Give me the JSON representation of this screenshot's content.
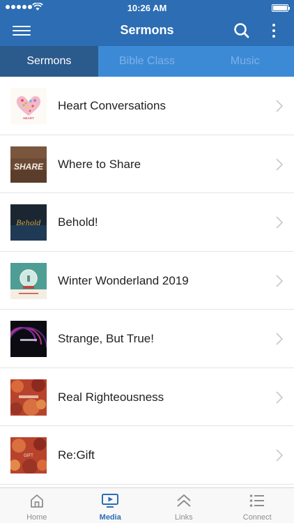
{
  "status_bar": {
    "time": "10:26 AM"
  },
  "header": {
    "title": "Sermons"
  },
  "tabs": [
    {
      "label": "Sermons",
      "active": true
    },
    {
      "label": "Bible Class",
      "active": false
    },
    {
      "label": "Music",
      "active": false
    }
  ],
  "sermons": [
    {
      "title": "Heart Conversations",
      "thumb_text": "HEART"
    },
    {
      "title": "Where to Share",
      "thumb_text": "SHARE"
    },
    {
      "title": "Behold!",
      "thumb_text": "Behold"
    },
    {
      "title": "Winter Wonderland 2019",
      "thumb_text": ""
    },
    {
      "title": "Strange, But True!",
      "thumb_text": ""
    },
    {
      "title": "Real Righteousness",
      "thumb_text": ""
    },
    {
      "title": "Re:Gift",
      "thumb_text": "GIFT"
    }
  ],
  "tabbar": [
    {
      "label": "Home",
      "icon": "home-icon",
      "active": false
    },
    {
      "label": "Media",
      "icon": "media-icon",
      "active": true
    },
    {
      "label": "Links",
      "icon": "links-icon",
      "active": false
    },
    {
      "label": "Connect",
      "icon": "connect-icon",
      "active": false
    }
  ],
  "colors": {
    "primary": "#2c6db3",
    "tab_bg": "#3c8ad6",
    "tab_active": "#2b5a8c"
  }
}
